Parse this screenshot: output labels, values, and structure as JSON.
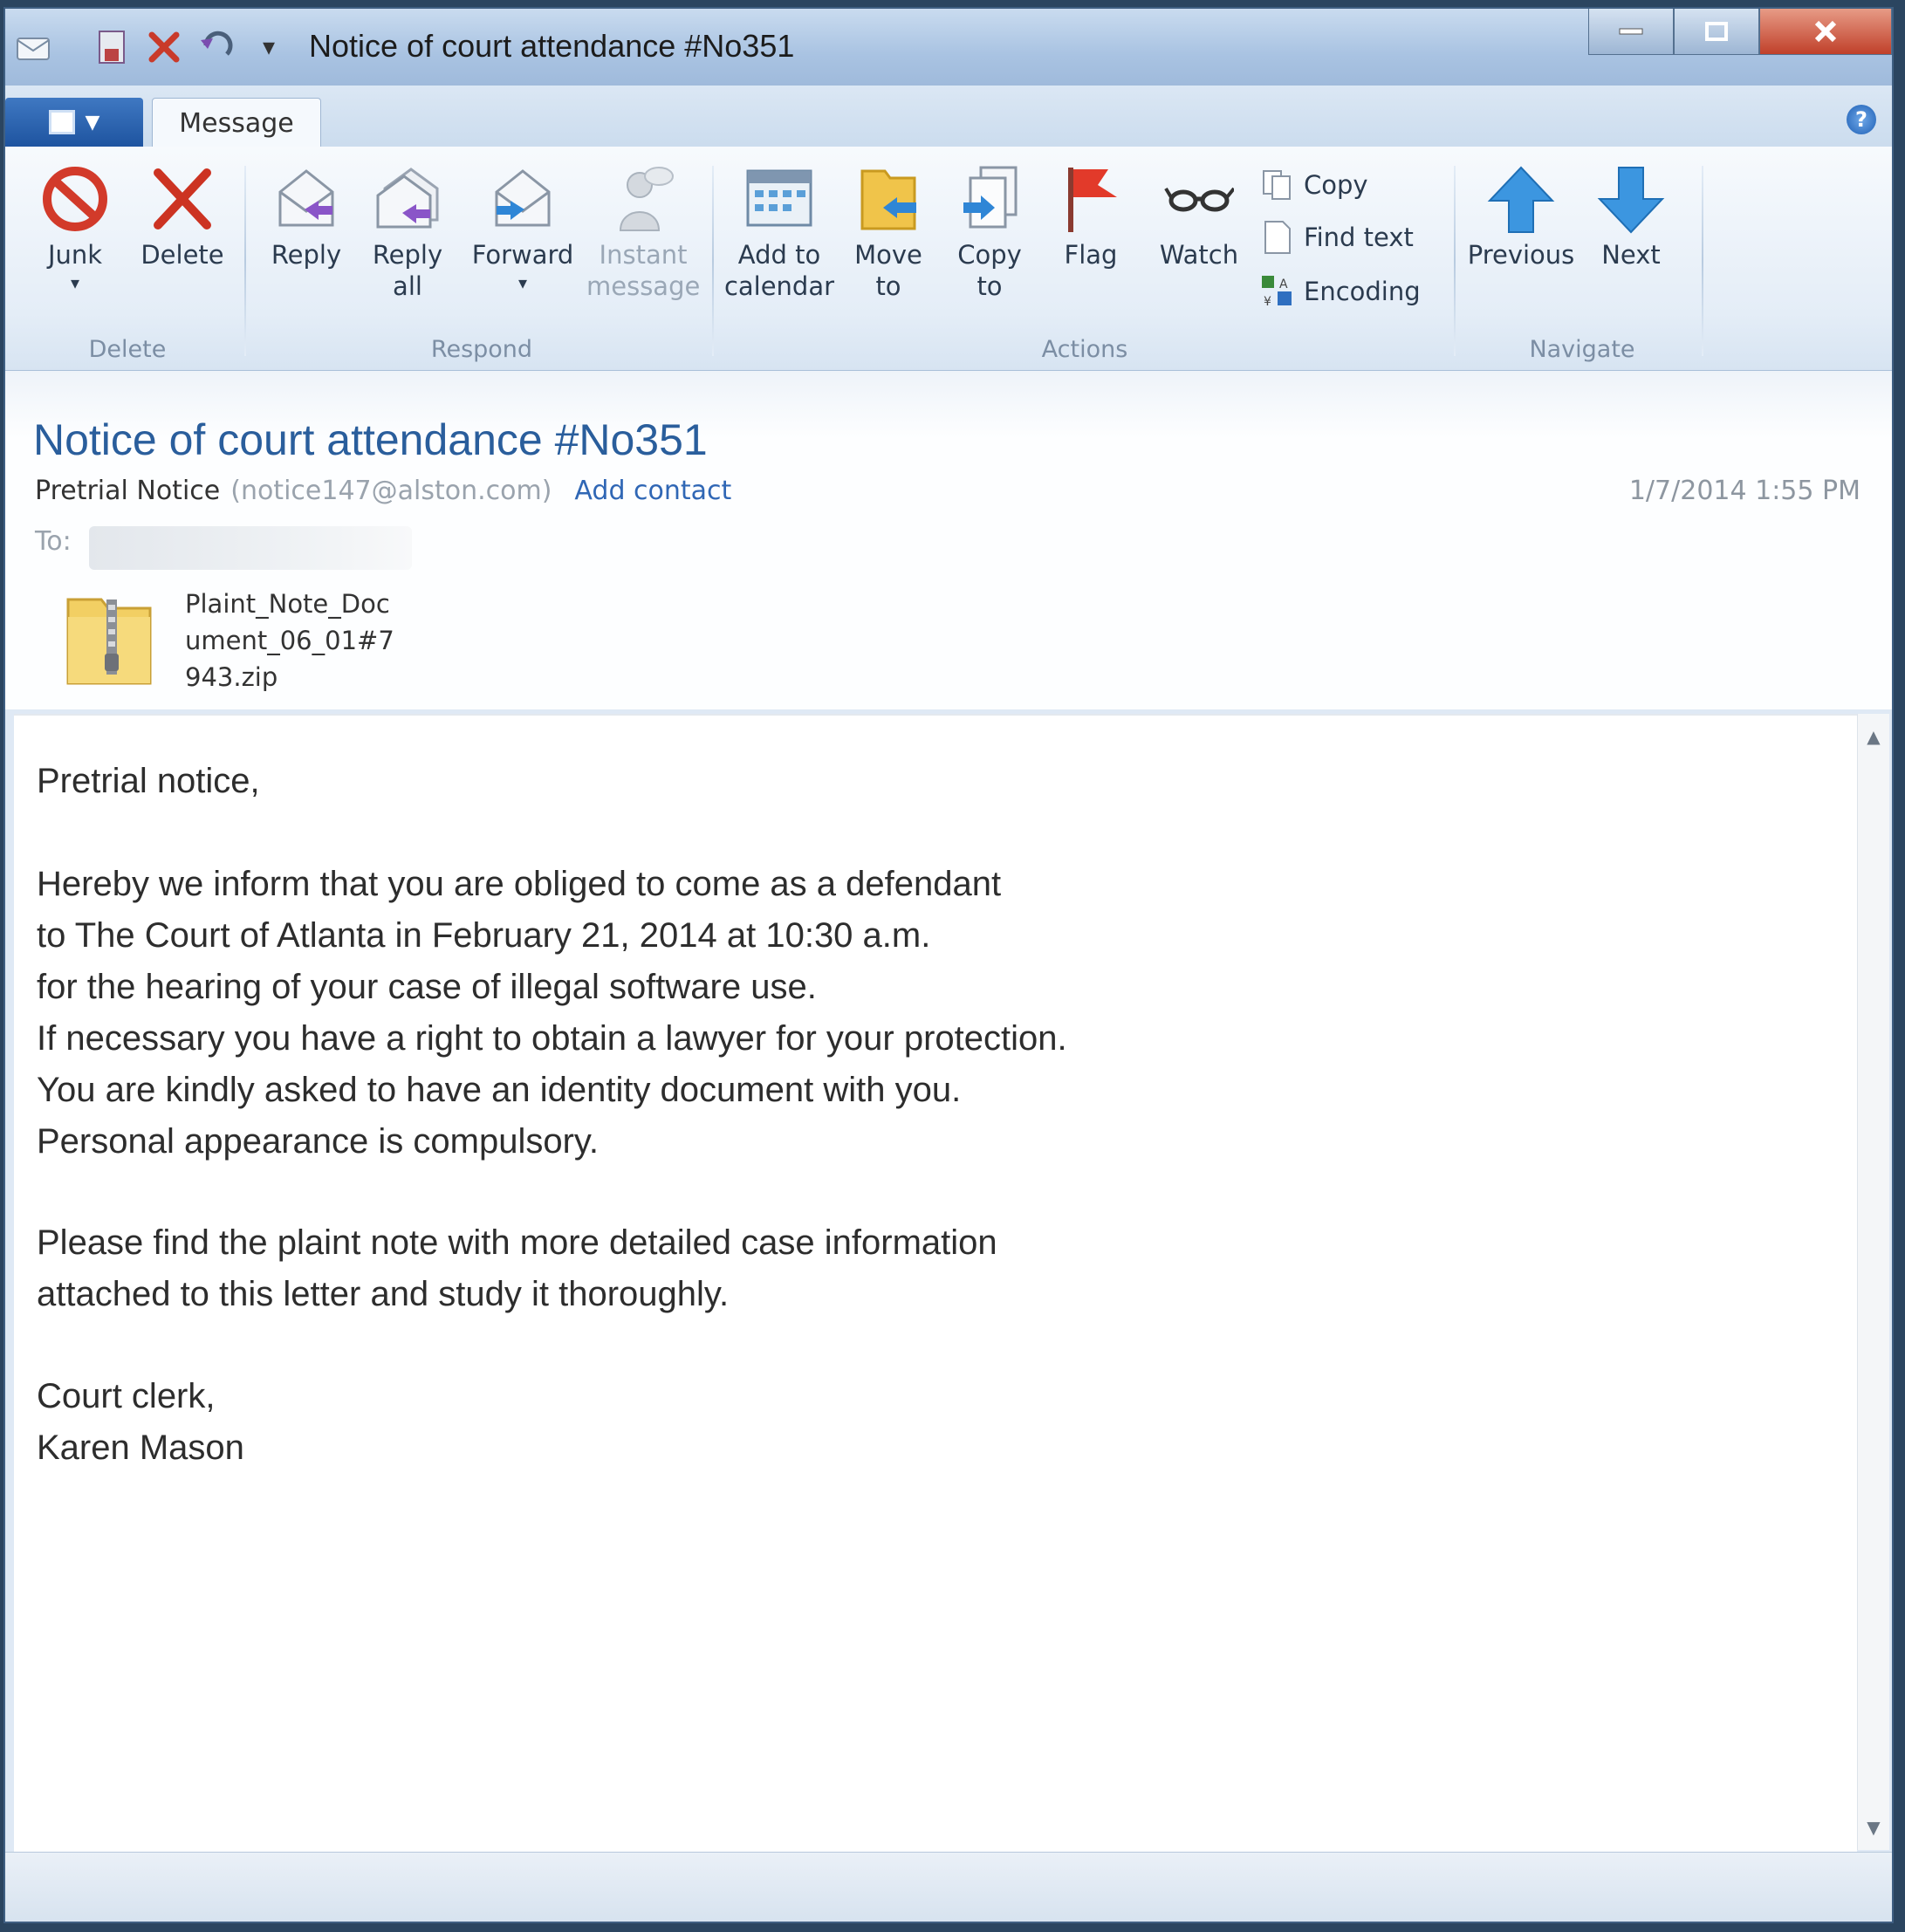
{
  "window": {
    "title": "Notice of court attendance #No351"
  },
  "ribbon": {
    "tab": "Message",
    "groups": {
      "delete": "Delete",
      "respond": "Respond",
      "actions": "Actions",
      "navigate": "Navigate"
    },
    "buttons": {
      "junk": "Junk",
      "delete": "Delete",
      "reply": "Reply",
      "reply_all_1": "Reply",
      "reply_all_2": "all",
      "forward": "Forward",
      "instant_1": "Instant",
      "instant_2": "message",
      "calendar_1": "Add to",
      "calendar_2": "calendar",
      "move_1": "Move",
      "move_2": "to",
      "copyto_1": "Copy",
      "copyto_2": "to",
      "flag": "Flag",
      "watch": "Watch",
      "copy": "Copy",
      "find_text": "Find text",
      "encoding": "Encoding",
      "previous": "Previous",
      "next": "Next"
    }
  },
  "message": {
    "subject": "Notice of court attendance #No351",
    "from_name": "Pretrial Notice",
    "from_email": "(notice147@alston.com)",
    "add_contact": "Add contact",
    "date": "1/7/2014 1:55 PM",
    "to_label": "To:",
    "attachment": "Plaint_Note_Document_06_01#7943.zip",
    "body": {
      "greeting": "Pretrial notice,",
      "p1": "Hereby we inform that you are obliged to come as a defendant\nto The Court of Atlanta in February 21, 2014 at 10:30 a.m.\nfor the hearing of your case of illegal software use.\nIf necessary you have a right to obtain a lawyer for your protection.\nYou are kindly asked to have an identity document with you.\nPersonal appearance is compulsory.",
      "p2": "Please find the plaint note with more detailed case information\nattached to this letter and study it thoroughly.",
      "sign": "Court clerk,\nKaren Mason"
    }
  },
  "colors": {
    "accent": "#2a5e9c",
    "link": "#3067b5",
    "close_red": "#c0402a"
  }
}
